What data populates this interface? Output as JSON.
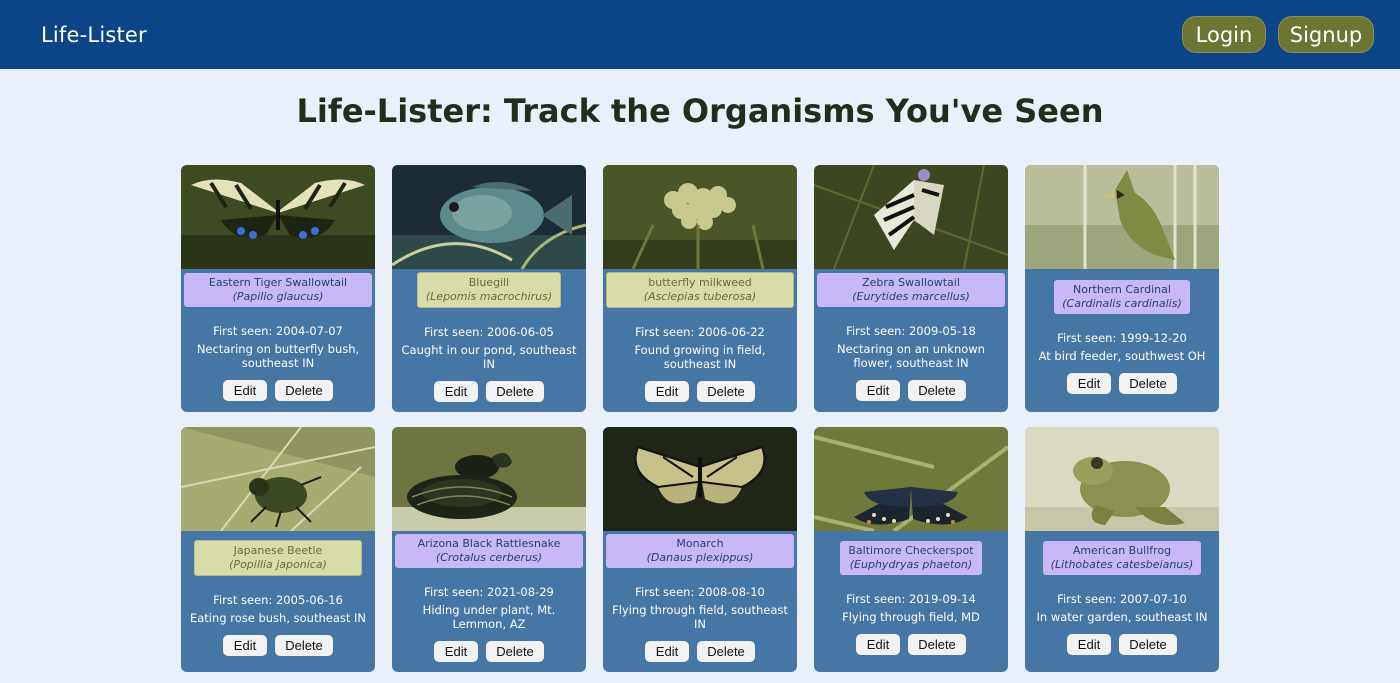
{
  "navbar": {
    "brand": "Life-Lister",
    "login_label": "Login",
    "signup_label": "Signup"
  },
  "page": {
    "title": "Life-Lister: Track the Organisms You've Seen"
  },
  "button_labels": {
    "edit": "Edit",
    "delete": "Delete"
  },
  "cards": [
    {
      "common": "Eastern Tiger Swallowtail",
      "scientific": "(Papilio glaucus)",
      "first_seen": "First seen: 2004-07-07",
      "note": "Nectaring on butterfly bush, southeast IN",
      "label_color": "purple"
    },
    {
      "common": "Bluegill",
      "scientific": "(Lepomis macrochirus)",
      "first_seen": "First seen: 2006-06-05",
      "note": "Caught in our pond, southeast IN",
      "label_color": "yellow"
    },
    {
      "common": "butterfly milkweed",
      "scientific": "(Asclepias tuberosa)",
      "first_seen": "First seen: 2006-06-22",
      "note": "Found growing in field, southeast IN",
      "label_color": "yellow"
    },
    {
      "common": "Zebra Swallowtail",
      "scientific": "(Eurytides marcellus)",
      "first_seen": "First seen: 2009-05-18",
      "note": "Nectaring on an unknown flower, southeast IN",
      "label_color": "purple"
    },
    {
      "common": "Northern Cardinal",
      "scientific": "(Cardinalis cardinalis)",
      "first_seen": "First seen: 1999-12-20",
      "note": "At bird feeder, southwest OH",
      "label_color": "purple"
    },
    {
      "common": "Japanese Beetle",
      "scientific": "(Popillia japonica)",
      "first_seen": "First seen: 2005-06-16",
      "note": "Eating rose bush, southeast IN",
      "label_color": "yellow"
    },
    {
      "common": "Arizona Black Rattlesnake",
      "scientific": "(Crotalus cerberus)",
      "first_seen": "First seen: 2021-08-29",
      "note": "Hiding under plant, Mt. Lemmon, AZ",
      "label_color": "purple"
    },
    {
      "common": "Monarch",
      "scientific": "(Danaus plexippus)",
      "first_seen": "First seen: 2008-08-10",
      "note": "Flying through field, southeast IN",
      "label_color": "purple"
    },
    {
      "common": "Baltimore Checkerspot",
      "scientific": "(Euphydryas phaeton)",
      "first_seen": "First seen: 2019-09-14",
      "note": "Flying through field, MD",
      "label_color": "purple"
    },
    {
      "common": "American Bullfrog",
      "scientific": "(Lithobates catesbeianus)",
      "first_seen": "First seen: 2007-07-10",
      "note": "In water garden, southeast IN",
      "label_color": "purple"
    }
  ]
}
